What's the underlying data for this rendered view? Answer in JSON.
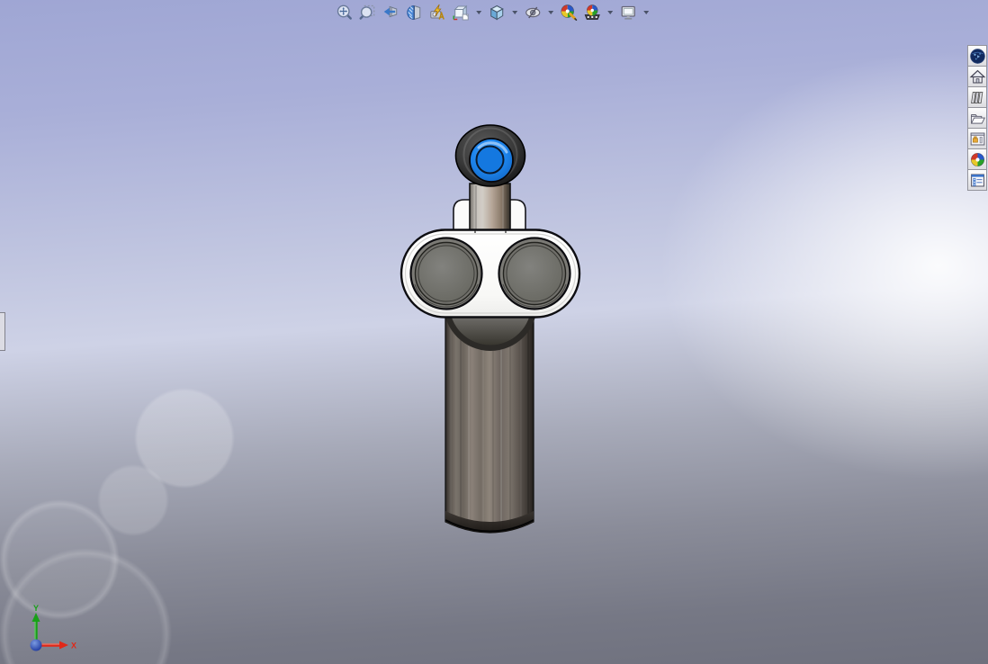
{
  "viewport": {
    "background_top": "#a0a7d5",
    "background_mid": "#ccd0e4",
    "background_bottom": "#6e707d",
    "highlight_white": "#f2f4fa"
  },
  "heads_up_toolbar": {
    "items": [
      {
        "id": "zoom-to-fit",
        "icon": "zoom-to-fit-icon",
        "has_dropdown": false
      },
      {
        "id": "zoom-to-area",
        "icon": "zoom-to-area-icon",
        "has_dropdown": false
      },
      {
        "id": "previous-view",
        "icon": "previous-view-icon",
        "has_dropdown": false
      },
      {
        "id": "section-view",
        "icon": "section-view-icon",
        "has_dropdown": false
      },
      {
        "id": "dynamic-annotation-views",
        "icon": "annotation-views-icon",
        "has_dropdown": false
      },
      {
        "id": "view-orientation",
        "icon": "view-orientation-icon",
        "has_dropdown": true
      },
      {
        "id": "display-style",
        "icon": "display-style-icon",
        "has_dropdown": true
      },
      {
        "id": "hide-show-items",
        "icon": "hide-show-items-icon",
        "has_dropdown": true
      },
      {
        "id": "edit-appearance",
        "icon": "edit-appearance-icon",
        "has_dropdown": false
      },
      {
        "id": "apply-scene",
        "icon": "apply-scene-icon",
        "has_dropdown": true
      },
      {
        "id": "view-settings",
        "icon": "view-settings-icon",
        "has_dropdown": true
      }
    ]
  },
  "task_pane": {
    "tabs": [
      {
        "id": "solidworks-resources",
        "icon": "globe-icon"
      },
      {
        "id": "home",
        "icon": "home-icon"
      },
      {
        "id": "design-library",
        "icon": "books-icon"
      },
      {
        "id": "file-explorer",
        "icon": "folder-icon"
      },
      {
        "id": "view-palette",
        "icon": "view-palette-icon"
      },
      {
        "id": "appearances-scenes",
        "icon": "beachball-icon"
      },
      {
        "id": "custom-properties",
        "icon": "form-icon"
      }
    ]
  },
  "model": {
    "parts": [
      "knob-ring",
      "blue-cap",
      "stem",
      "collar",
      "plate",
      "bore-left",
      "bore-right",
      "boss-dome",
      "column"
    ],
    "accent_blue": "#1e86ee",
    "body_white": "#fcfcfc",
    "metal_gray": "#77766f",
    "knob_dark": "#262626"
  },
  "triad": {
    "x_label": "X",
    "y_label": "Y",
    "x_color": "#e02818",
    "y_color": "#18a018",
    "origin_color": "#2244bb"
  }
}
